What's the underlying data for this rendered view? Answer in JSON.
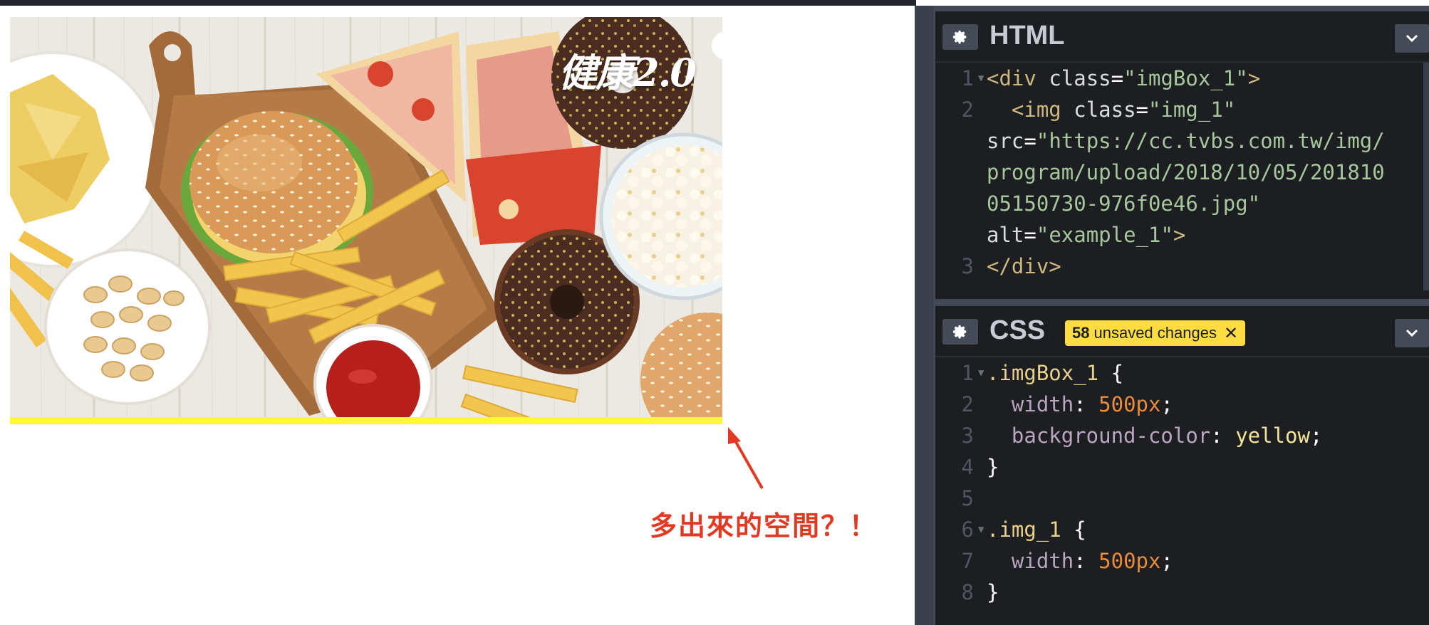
{
  "preview": {
    "image_alt": "example_1",
    "watermark": "健康2.0",
    "annotation": "多出來的空間？！"
  },
  "html_panel": {
    "title": "HTML",
    "settings_icon": "gear-icon",
    "collapse_icon": "chevron-down-icon",
    "lines": [
      {
        "num": "1",
        "fold": true,
        "text": "<div class=\"imgBox_1\">"
      },
      {
        "num": "2",
        "fold": false,
        "text": "  <img class=\"img_1\""
      },
      {
        "num": "",
        "fold": false,
        "text": "src=\"https://cc.tvbs.com.tw/img/"
      },
      {
        "num": "",
        "fold": false,
        "text": "program/upload/2018/10/05/201810"
      },
      {
        "num": "",
        "fold": false,
        "text": "05150730-976f0e46.jpg\""
      },
      {
        "num": "",
        "fold": false,
        "text": "alt=\"example_1\">"
      },
      {
        "num": "3",
        "fold": false,
        "text": "</div>"
      }
    ]
  },
  "css_panel": {
    "title": "CSS",
    "settings_icon": "gear-icon",
    "collapse_icon": "chevron-down-icon",
    "badge_count": "58",
    "badge_text": "unsaved changes",
    "badge_close": "✕",
    "lines": [
      {
        "num": "1",
        "fold": true,
        "text": ".imgBox_1 {"
      },
      {
        "num": "2",
        "fold": false,
        "text": "  width: 500px;"
      },
      {
        "num": "3",
        "fold": false,
        "text": "  background-color: yellow;"
      },
      {
        "num": "4",
        "fold": false,
        "text": "}"
      },
      {
        "num": "5",
        "fold": false,
        "text": ""
      },
      {
        "num": "6",
        "fold": true,
        "text": ".img_1 {"
      },
      {
        "num": "7",
        "fold": false,
        "text": "  width: 500px;"
      },
      {
        "num": "8",
        "fold": false,
        "text": "}"
      }
    ]
  },
  "colors": {
    "highlight_yellow": "#fff832",
    "annotation_red": "#e23a22",
    "editor_bg": "#1d1e22",
    "badge_yellow": "#ffdd40"
  }
}
